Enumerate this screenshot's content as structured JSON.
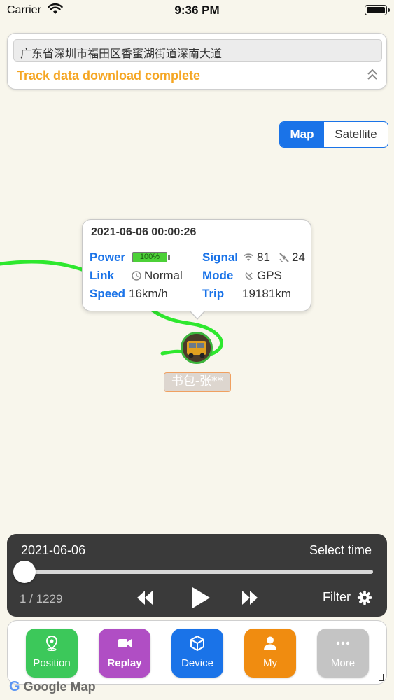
{
  "status_bar": {
    "carrier": "Carrier",
    "time": "9:36 PM"
  },
  "address_panel": {
    "address": "广东省深圳市福田区香蜜湖街道深南大道",
    "status": "Track data download complete",
    "status_color": "#f5a623"
  },
  "map_type": {
    "map_label": "Map",
    "satellite_label": "Satellite",
    "selected": "Map"
  },
  "popup": {
    "datetime": "2021-06-06 00:00:26",
    "power_label": "Power",
    "power_value": "100%",
    "signal_label": "Signal",
    "signal_value": "81",
    "satellites_value": "24",
    "link_label": "Link",
    "link_value": "Normal",
    "mode_label": "Mode",
    "mode_value": "GPS",
    "speed_label": "Speed",
    "speed_value": "16km/h",
    "trip_label": "Trip",
    "trip_value": "19181km"
  },
  "vehicle": {
    "name": "书包-张**"
  },
  "playback": {
    "date": "2021-06-06",
    "select_time_label": "Select time",
    "progress_fraction": 0,
    "position_text": "1 / 1229",
    "filter_label": "Filter"
  },
  "tabs": [
    {
      "label": "Position",
      "icon": "location-pin-icon",
      "color": "#3cc85a"
    },
    {
      "label": "Replay",
      "icon": "video-camera-icon",
      "color": "#b04ec4",
      "active": true
    },
    {
      "label": "Device",
      "icon": "cube-icon",
      "color": "#1a73e8"
    },
    {
      "label": "My",
      "icon": "person-icon",
      "color": "#f08c10"
    },
    {
      "label": "More",
      "icon": "more-dots-icon",
      "color": "#c4c4c4"
    }
  ],
  "map_attribution": "Google Map",
  "colors": {
    "accent_blue": "#1a73e8",
    "track_green": "#2ee82e",
    "map_background": "#f8f6ec"
  }
}
